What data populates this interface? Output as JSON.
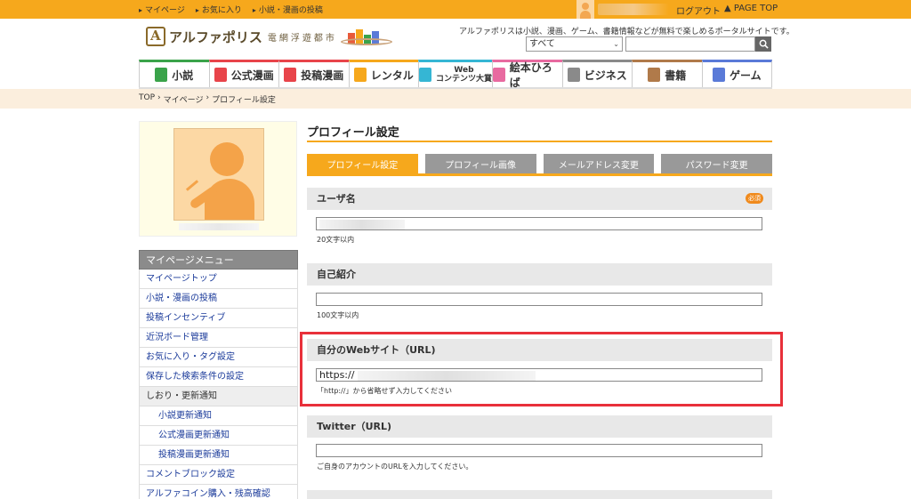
{
  "topbar": {
    "links": [
      "マイページ",
      "お気に入り",
      "小説・漫画の投稿"
    ],
    "logout": "ログアウト",
    "page_top": "▲ PAGE TOP"
  },
  "header": {
    "logo_name": "アルファポリス",
    "logo_sub": "電網浮遊都市",
    "tagline": "アルファポリスは小説、漫画、ゲーム、書籍情報などが無料で楽しめるポータルサイトです。",
    "search_select": "すべて"
  },
  "nav": [
    {
      "label": "小説",
      "icon": "book-icon",
      "color": "#3aa34a"
    },
    {
      "label": "公式漫画",
      "icon": "manga-icon",
      "color": "#e8444a"
    },
    {
      "label": "投稿漫画",
      "icon": "manga-post-icon",
      "color": "#e8444a"
    },
    {
      "label": "レンタル",
      "icon": "rental-icon",
      "color": "#f6a81c"
    },
    {
      "label": "Web\nコンテンツ大賞",
      "icon": "award-icon",
      "color": "#35b6d4"
    },
    {
      "label": "絵本ひろば",
      "icon": "picturebook-icon",
      "color": "#e86aa0"
    },
    {
      "label": "ビジネス",
      "icon": "chart-icon",
      "color": "#8a8a8a"
    },
    {
      "label": "書籍",
      "icon": "open-book-icon",
      "color": "#b07a4a"
    },
    {
      "label": "ゲーム",
      "icon": "gamepad-icon",
      "color": "#5a7ad8"
    }
  ],
  "breadcrumb": [
    "TOP",
    "›",
    "マイページ",
    "›",
    "プロフィール設定"
  ],
  "menu": {
    "title": "マイページメニュー",
    "items": [
      {
        "label": "マイページトップ",
        "type": "link"
      },
      {
        "label": "小説・漫画の投稿",
        "type": "link"
      },
      {
        "label": "投稿インセンティブ",
        "type": "link"
      },
      {
        "label": "近況ボード管理",
        "type": "link"
      },
      {
        "label": "お気に入り・タグ設定",
        "type": "link"
      },
      {
        "label": "保存した検索条件の設定",
        "type": "link"
      },
      {
        "label": "しおり・更新通知",
        "type": "section"
      },
      {
        "label": "小説更新通知",
        "type": "sub"
      },
      {
        "label": "公式漫画更新通知",
        "type": "sub"
      },
      {
        "label": "投稿漫画更新通知",
        "type": "sub"
      },
      {
        "label": "コメントブロック設定",
        "type": "link"
      },
      {
        "label": "アルファコイン購入・残高確認",
        "type": "link"
      }
    ]
  },
  "main": {
    "title": "プロフィール設定",
    "tabs": [
      "プロフィール設定",
      "プロフィール画像",
      "メールアドレス変更",
      "パスワード変更"
    ],
    "fields": {
      "username": {
        "label": "ユーザ名",
        "required_badge": "必須",
        "hint": "20文字以内"
      },
      "bio": {
        "label": "自己紹介",
        "hint": "100文字以内"
      },
      "website": {
        "label": "自分のWebサイト（URL)",
        "value": "https://",
        "hint": "「http://」から省略せず入力してください"
      },
      "twitter": {
        "label": "Twitter（URL)",
        "hint": "ご自身のアカウントのURLを入力してください。"
      }
    }
  }
}
